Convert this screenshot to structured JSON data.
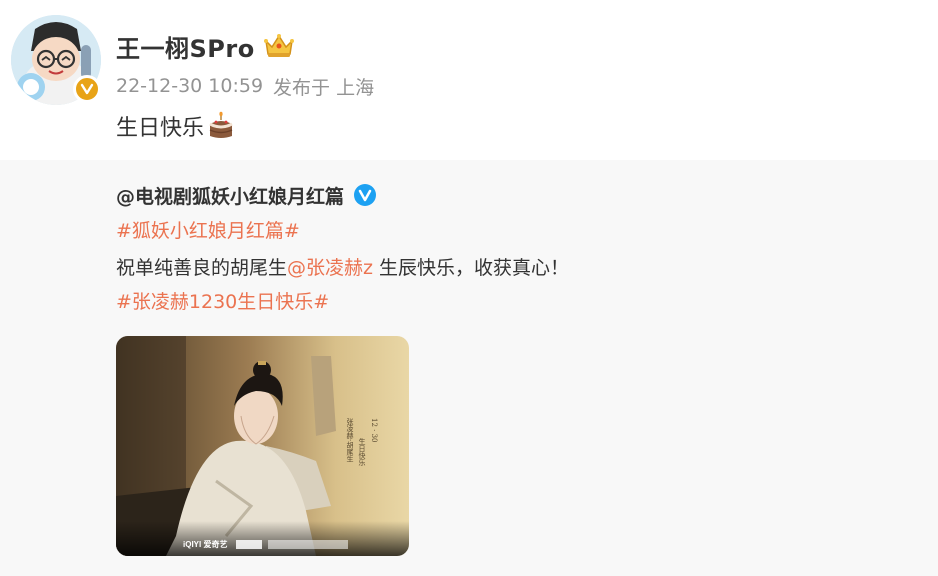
{
  "post": {
    "username": "王一栩SPro",
    "time": "22-12-30 10:59",
    "posted_from": "发布于 上海",
    "text": "生日快乐",
    "crown_icon": "crown-badge-icon",
    "cake_icon": "birthday-cake-icon"
  },
  "repost": {
    "author": "@电视剧狐妖小红娘月红篇",
    "verified_icon": "blue-v-verified-icon",
    "topic1": "#狐妖小红娘月红篇#",
    "line2_prefix": "祝单纯善良的胡尾生",
    "mention": "@张凌赫z",
    "line2_suffix": " 生辰快乐，收获真心！",
    "topic2": "#张凌赫1230生日快乐#"
  },
  "photo": {
    "poster_text_1": "12 · 30",
    "poster_text_2": "生日快乐",
    "poster_text_3": "张凌赫·胡尾生",
    "footer_text": "iQIYI 爱奇艺"
  },
  "colors": {
    "accent": "#eb7350",
    "muted": "#939393",
    "text": "#333333",
    "repost_bg": "#f8f8f8",
    "verified_blue": "#1da1f2",
    "badge_gold": "#e8a317"
  }
}
